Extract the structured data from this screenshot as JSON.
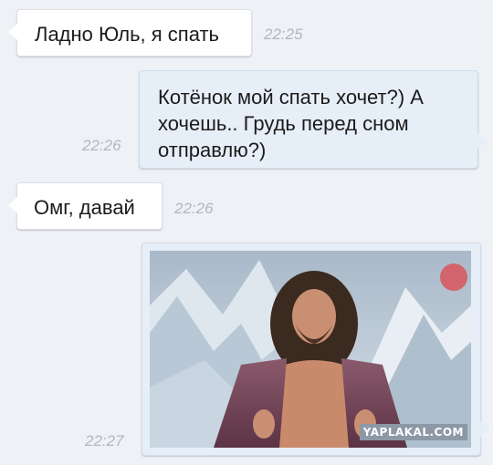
{
  "messages": [
    {
      "direction": "incoming",
      "text": "Ладно Юль, я спать",
      "time": "22:25"
    },
    {
      "direction": "outgoing",
      "lines": [
        "Котёнок мой спать хочет?) А",
        "хочешь.. Грудь перед сном",
        "отправлю?)"
      ],
      "time": "22:26"
    },
    {
      "direction": "incoming",
      "text": "Омг, давай",
      "time": "22:26"
    },
    {
      "direction": "outgoing",
      "type": "image",
      "image_description_icon": "photo-icon",
      "watermark": "YAPLAKAL.COM",
      "time": "22:27"
    }
  ],
  "colors": {
    "background": "#eef1f5",
    "incoming_bubble": "#ffffff",
    "outgoing_bubble": "#e6eef8",
    "timestamp": "#b2b8c2"
  }
}
